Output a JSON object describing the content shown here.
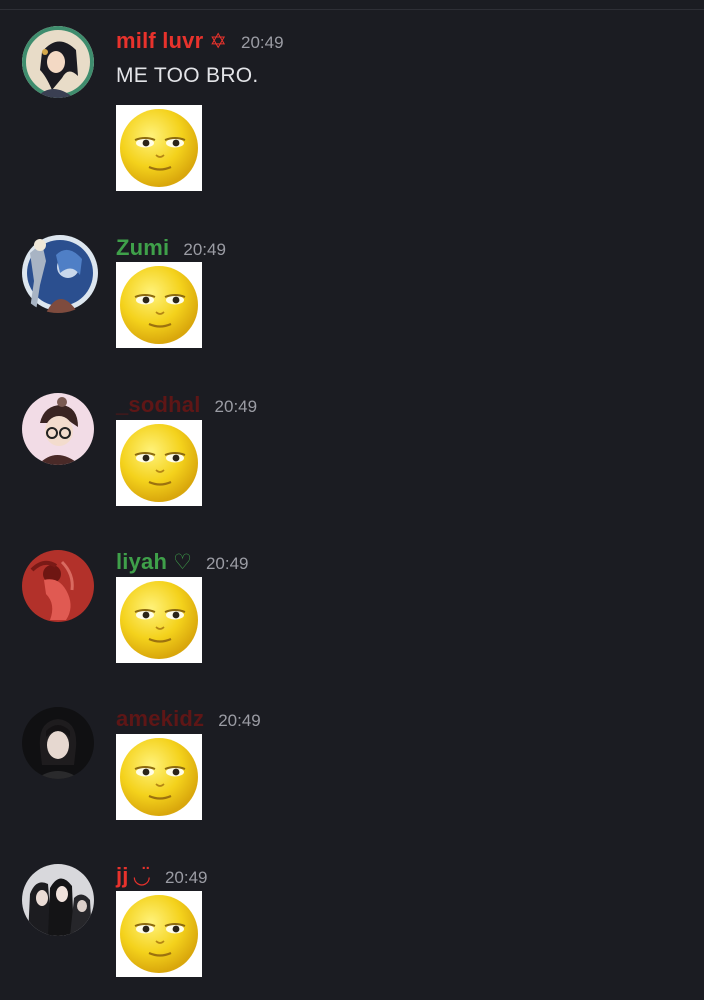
{
  "colors": {
    "background": "#1b1c22",
    "timestamp": "#9b9ca4",
    "message_text": "#e3e4e8",
    "role_red": "#e8322c",
    "role_green": "#3fa04a",
    "role_darkred": "#5e1616"
  },
  "messages": [
    {
      "username": "milf luvr",
      "badge": "✡",
      "badge_icon": "star-icon",
      "time": "20:49",
      "text": "ME TOO BRO.",
      "attachment_icon": "moon-face-emoji-icon",
      "name_color": "#e8322c"
    },
    {
      "username": "Zumi",
      "time": "20:49",
      "attachment_icon": "moon-face-emoji-icon",
      "name_color": "#3fa04a"
    },
    {
      "username": "_sodhal",
      "time": "20:49",
      "attachment_icon": "moon-face-emoji-icon",
      "name_color": "#5e1616"
    },
    {
      "username": "liyah",
      "badge": "♡",
      "badge_icon": "heart-icon",
      "time": "20:49",
      "attachment_icon": "moon-face-emoji-icon",
      "name_color": "#3fa04a"
    },
    {
      "username": "amekidz",
      "time": "20:49",
      "attachment_icon": "moon-face-emoji-icon",
      "name_color": "#5e1616"
    },
    {
      "username": "jj",
      "badge": "◡̈",
      "badge_icon": "smile-icon",
      "time": "20:49",
      "attachment_icon": "moon-face-emoji-icon",
      "name_color": "#e8322c"
    }
  ]
}
